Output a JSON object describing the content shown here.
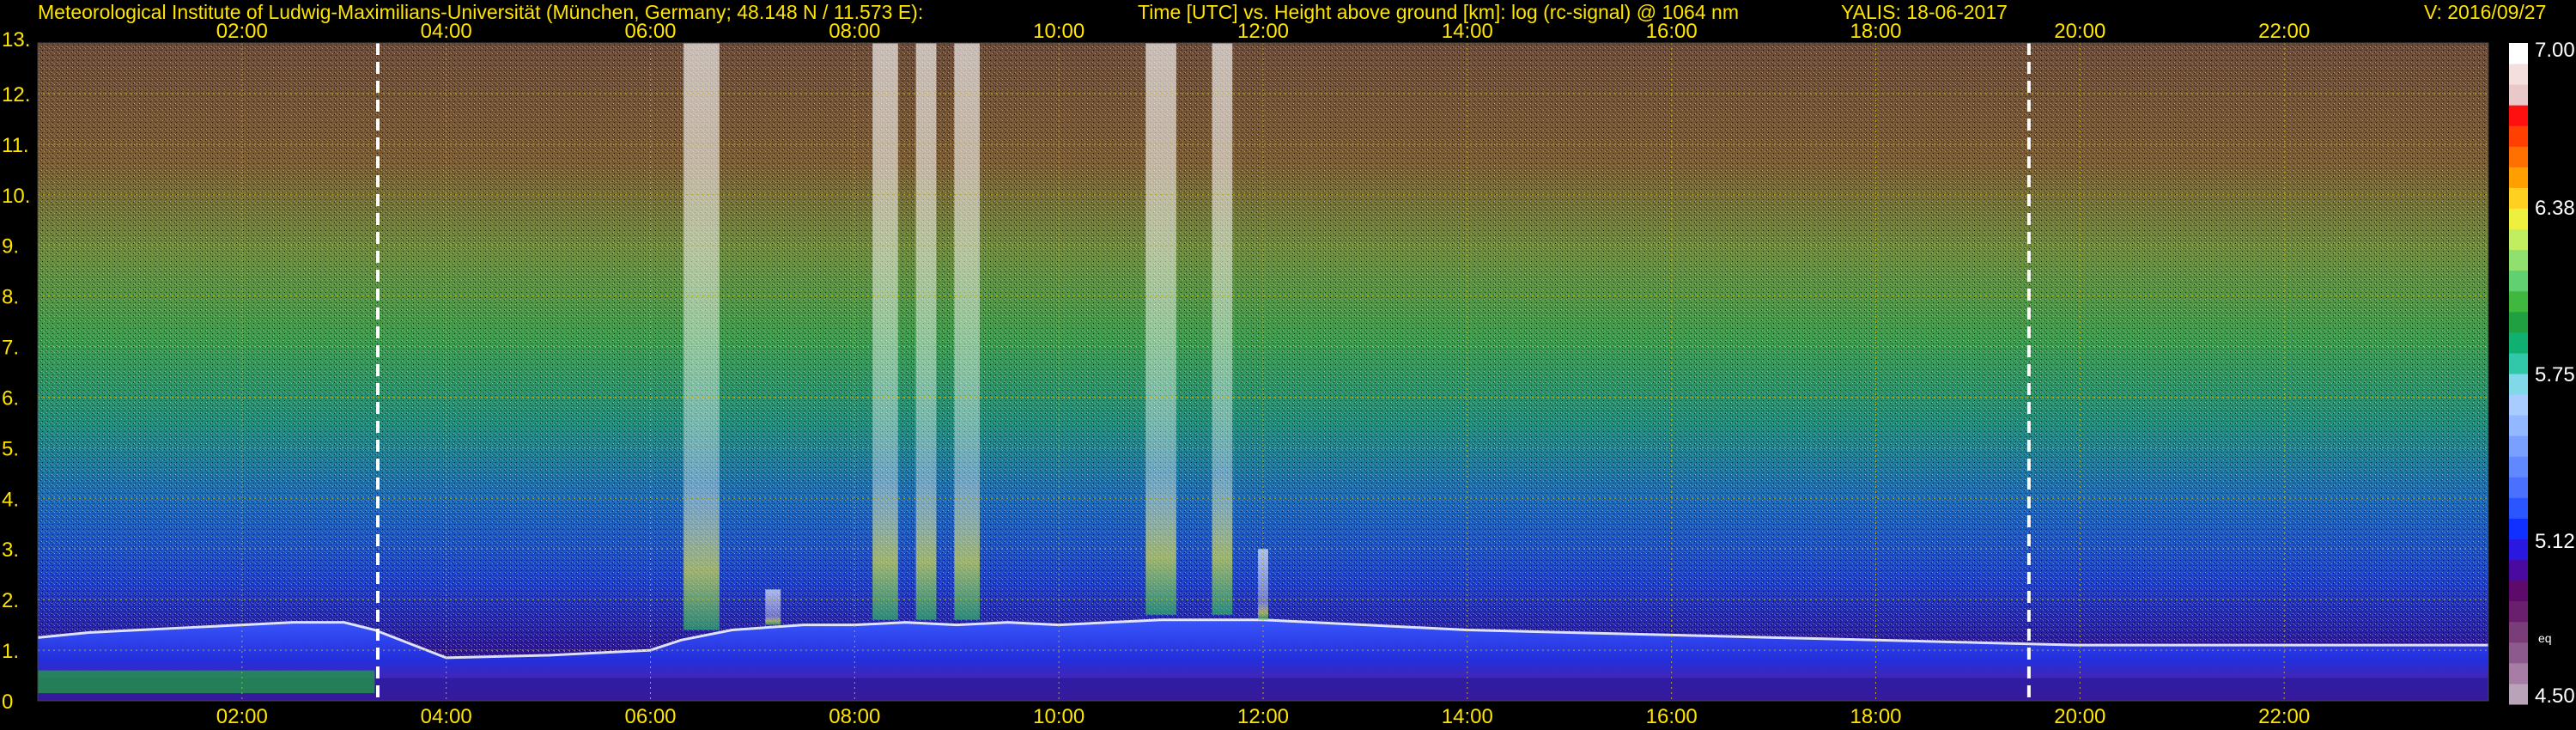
{
  "header": {
    "institute": "Meteorological Institute of Ludwig-Maximilians-Universität (München, Germany; 48.148 N / 11.573 E):",
    "description": "Time [UTC] vs. Height above ground [km]: log (rc-signal) @ 1064 nm",
    "station_date": "YALIS: 18-06-2017",
    "version": "V: 2016/09/27"
  },
  "colors": {
    "background": "#000000",
    "label": "#ffe400",
    "grid": "#c8b400",
    "marker_line": "#ffffff"
  },
  "chart_data": {
    "type": "heatmap",
    "x_unit": "hours UTC",
    "y_unit": "km",
    "xlim": [
      0,
      24
    ],
    "ylim": [
      0,
      13
    ],
    "x_ticks": [
      {
        "value": 2,
        "label": "02:00"
      },
      {
        "value": 4,
        "label": "04:00"
      },
      {
        "value": 6,
        "label": "06:00"
      },
      {
        "value": 8,
        "label": "08:00"
      },
      {
        "value": 10,
        "label": "10:00"
      },
      {
        "value": 12,
        "label": "12:00"
      },
      {
        "value": 14,
        "label": "14:00"
      },
      {
        "value": 16,
        "label": "16:00"
      },
      {
        "value": 18,
        "label": "18:00"
      },
      {
        "value": 20,
        "label": "20:00"
      },
      {
        "value": 22,
        "label": "22:00"
      }
    ],
    "y_ticks": [
      {
        "value": 0,
        "label": "0"
      },
      {
        "value": 1,
        "label": "1."
      },
      {
        "value": 2,
        "label": "2."
      },
      {
        "value": 3,
        "label": "3."
      },
      {
        "value": 4,
        "label": "4."
      },
      {
        "value": 5,
        "label": "5."
      },
      {
        "value": 6,
        "label": "6."
      },
      {
        "value": 7,
        "label": "7."
      },
      {
        "value": 8,
        "label": "8."
      },
      {
        "value": 9,
        "label": "9."
      },
      {
        "value": 10,
        "label": "10."
      },
      {
        "value": 11,
        "label": "11."
      },
      {
        "value": 12,
        "label": "12."
      },
      {
        "value": 13,
        "label": "13."
      }
    ],
    "grid": true,
    "marker_lines_x": [
      3.33,
      19.5
    ],
    "colorbar": {
      "min": 4.5,
      "max": 7.0,
      "labels": [
        {
          "value": 7.0,
          "label": "7.00"
        },
        {
          "value": 6.38,
          "label": "6.38"
        },
        {
          "value": 5.75,
          "label": "5.75"
        },
        {
          "value": 5.12,
          "label": "5.12"
        },
        {
          "value": 4.5,
          "label": "4.50"
        }
      ],
      "mark_label": "eq",
      "mark_value": 4.75,
      "colors_bottom_to_top": [
        "#b9a3b9",
        "#a57da5",
        "#8c5a8c",
        "#7a3d7a",
        "#6a1f6e",
        "#5e0a6a",
        "#4a0aa0",
        "#2a18e0",
        "#1030ff",
        "#2a55ff",
        "#4a70ff",
        "#6088ff",
        "#7aa0ff",
        "#94b8ff",
        "#a8ccff",
        "#80d8e8",
        "#30c8a8",
        "#10b070",
        "#20a040",
        "#40b840",
        "#60d070",
        "#90e070",
        "#c0ee60",
        "#eef040",
        "#ffd020",
        "#ffa000",
        "#ff7000",
        "#ff4000",
        "#ff1010",
        "#e8c8c8",
        "#f4dede",
        "#ffffff"
      ]
    },
    "pbl_top_km": [
      [
        0.0,
        1.25
      ],
      [
        0.5,
        1.35
      ],
      [
        1.0,
        1.4
      ],
      [
        1.5,
        1.45
      ],
      [
        2.0,
        1.5
      ],
      [
        2.5,
        1.55
      ],
      [
        3.0,
        1.55
      ],
      [
        3.3,
        1.4
      ],
      [
        4.0,
        0.85
      ],
      [
        5.0,
        0.9
      ],
      [
        6.0,
        1.0
      ],
      [
        6.3,
        1.2
      ],
      [
        6.8,
        1.4
      ],
      [
        7.5,
        1.5
      ],
      [
        8.0,
        1.5
      ],
      [
        8.5,
        1.55
      ],
      [
        9.0,
        1.5
      ],
      [
        9.5,
        1.55
      ],
      [
        10.0,
        1.5
      ],
      [
        10.5,
        1.55
      ],
      [
        11.0,
        1.6
      ],
      [
        11.5,
        1.6
      ],
      [
        12.0,
        1.6
      ],
      [
        13.0,
        1.5
      ],
      [
        14.0,
        1.4
      ],
      [
        15.0,
        1.35
      ],
      [
        16.0,
        1.3
      ],
      [
        17.0,
        1.25
      ],
      [
        18.0,
        1.2
      ],
      [
        19.0,
        1.15
      ],
      [
        20.0,
        1.1
      ],
      [
        21.0,
        1.1
      ],
      [
        22.0,
        1.1
      ],
      [
        23.0,
        1.1
      ],
      [
        24.0,
        1.1
      ]
    ],
    "plumes": [
      {
        "x": 6.5,
        "width": 0.35,
        "top": 13.0,
        "base": 1.4
      },
      {
        "x": 7.2,
        "width": 0.15,
        "top": 2.2,
        "base": 1.5
      },
      {
        "x": 8.3,
        "width": 0.25,
        "top": 13.0,
        "base": 1.6
      },
      {
        "x": 8.7,
        "width": 0.2,
        "top": 13.0,
        "base": 1.6
      },
      {
        "x": 9.1,
        "width": 0.25,
        "top": 13.0,
        "base": 1.6
      },
      {
        "x": 11.0,
        "width": 0.3,
        "top": 13.0,
        "base": 1.7
      },
      {
        "x": 11.6,
        "width": 0.2,
        "top": 13.0,
        "base": 1.7
      },
      {
        "x": 12.0,
        "width": 0.1,
        "top": 3.0,
        "base": 1.6
      }
    ]
  }
}
